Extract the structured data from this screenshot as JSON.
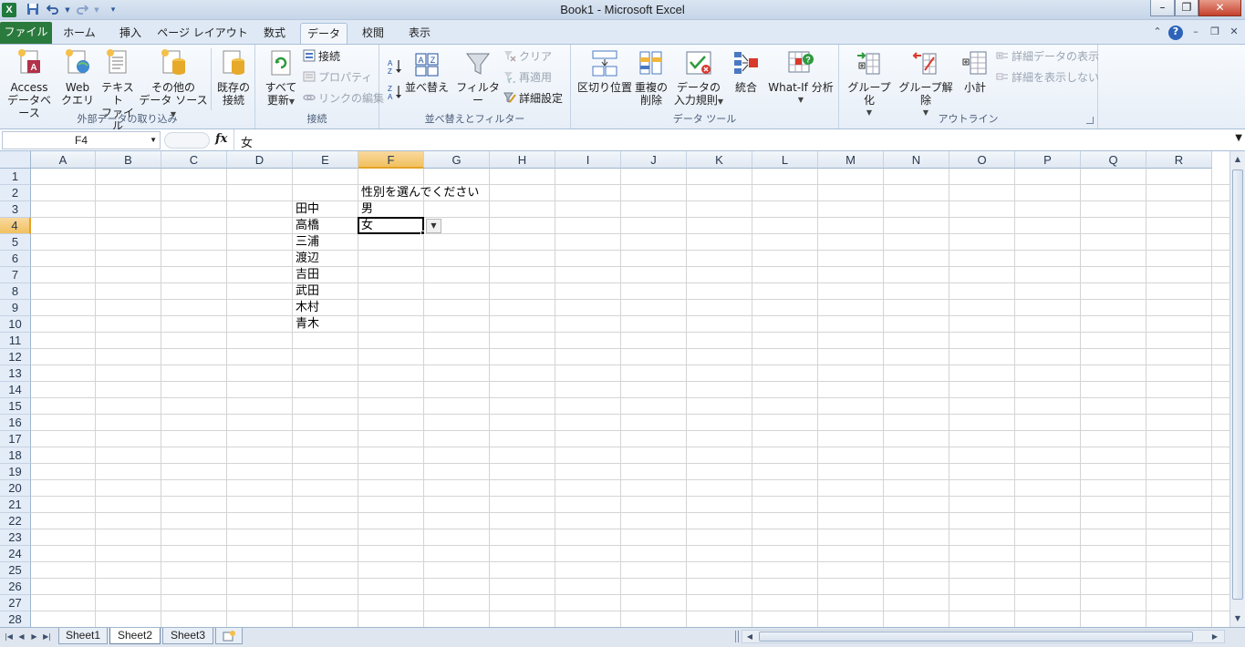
{
  "window": {
    "title": "Book1 - Microsoft Excel",
    "app_icon_letter": "X",
    "minimize": "–",
    "restore": "❐",
    "close": "✕"
  },
  "quick_access": [
    "save-icon",
    "undo-icon",
    "redo-icon",
    "customize-icon"
  ],
  "tabs": [
    "ファイル",
    "ホーム",
    "挿入",
    "ページ レイアウト",
    "数式",
    "データ",
    "校閲",
    "表示"
  ],
  "active_tab": "データ",
  "ribbon": {
    "external_data": {
      "label": "外部データの取り込み",
      "access": [
        "Access",
        "データベース"
      ],
      "web": [
        "Web",
        "クエリ"
      ],
      "text": [
        "テキスト",
        "ファイル"
      ],
      "other": [
        "その他の",
        "データ ソース"
      ],
      "existing": [
        "既存の",
        "接続"
      ]
    },
    "connections": {
      "label": "接続",
      "refresh_all": [
        "すべて",
        "更新"
      ],
      "connections": "接続",
      "properties": "プロパティ",
      "edit_links": "リンクの編集"
    },
    "sort_filter": {
      "label": "並べ替えとフィルター",
      "sort_az": "A→Z",
      "sort_za": "Z→A",
      "sort": "並べ替え",
      "filter": "フィルター",
      "clear": "クリア",
      "reapply": "再適用",
      "advanced": "詳細設定"
    },
    "data_tools": {
      "label": "データ ツール",
      "text_to_columns": "区切り位置",
      "remove_duplicates": [
        "重複の",
        "削除"
      ],
      "validation": [
        "データの",
        "入力規則"
      ],
      "consolidate": "統合",
      "whatif": "What-If 分析"
    },
    "outline": {
      "label": "アウトライン",
      "group": "グループ化",
      "ungroup": "グループ解除",
      "subtotal": "小計",
      "show_detail": "詳細データの表示",
      "hide_detail": "詳細を表示しない"
    }
  },
  "formula_bar": {
    "name_box": "F4",
    "fx": "fx",
    "value": "女"
  },
  "columns": [
    "A",
    "B",
    "C",
    "D",
    "E",
    "F",
    "G",
    "H",
    "I",
    "J",
    "K",
    "L",
    "M",
    "N",
    "O",
    "P",
    "Q",
    "R"
  ],
  "selected_column": "F",
  "rows": [
    "1",
    "2",
    "3",
    "4",
    "5",
    "6",
    "7",
    "8",
    "9",
    "10",
    "11",
    "12",
    "13",
    "14",
    "15",
    "16",
    "17",
    "18",
    "19",
    "20",
    "21",
    "22",
    "23",
    "24",
    "25",
    "26",
    "27",
    "28"
  ],
  "selected_row": "4",
  "cells": {
    "F2": "性別を選んでください",
    "E3": "田中",
    "F3": "男",
    "E4": "高橋",
    "F4": "女",
    "E5": "三浦",
    "E6": "渡辺",
    "E7": "吉田",
    "E8": "武田",
    "E9": "木村",
    "E10": "青木"
  },
  "sheets": [
    "Sheet1",
    "Sheet2",
    "Sheet3"
  ],
  "active_sheet": "Sheet2"
}
